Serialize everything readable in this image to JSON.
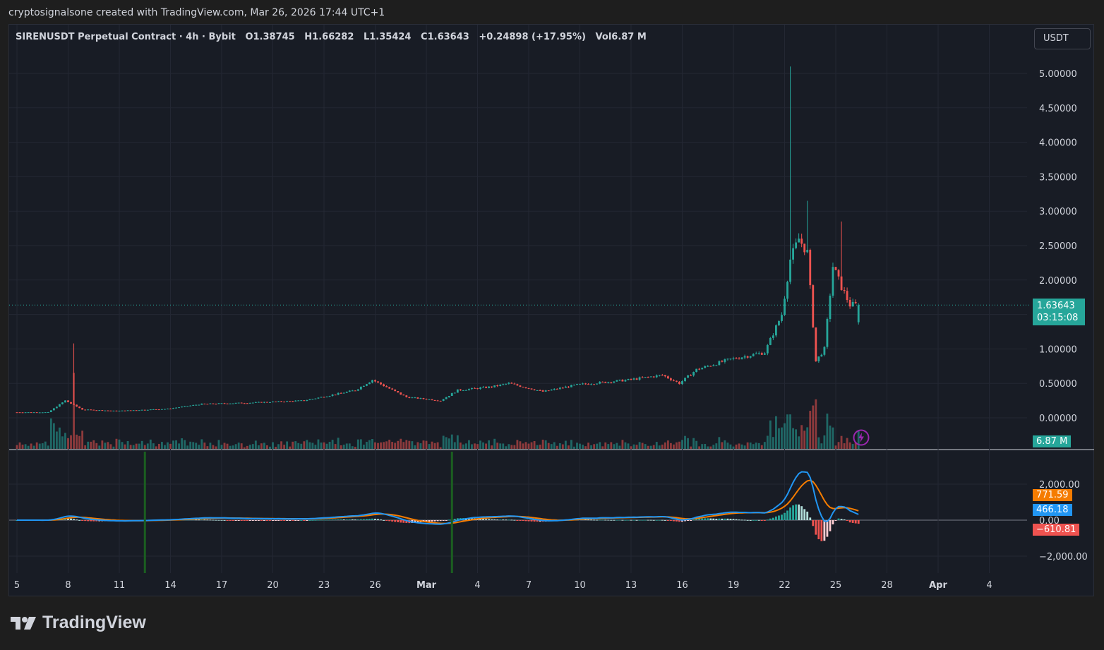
{
  "caption": "cryptosignalsone created with TradingView.com, Mar 26, 2026 17:44 UTC+1",
  "legend": {
    "symbol": "SIRENUSDT Perpetual Contract · 4h · Bybit",
    "open": "O1.38745",
    "high": "H1.66282",
    "low": "L1.35424",
    "close": "C1.63643",
    "change": "+0.24898 (+17.95%)",
    "volume": "Vol6.87 M"
  },
  "currency_button": "USDT",
  "last_price": "1.63643",
  "countdown": "03:15:08",
  "volume_tag": "6.87 M",
  "macd_signal_tag": "771.59",
  "macd_line_tag": "466.18",
  "macd_hist_tag": "−610.81",
  "brand": "TradingView",
  "icons": {
    "brand_logo": "tradingview-logo-icon",
    "flash": "lightning-icon"
  },
  "colors": {
    "up": "#26a69a",
    "down": "#ef5350",
    "macd": "#2196f3",
    "signal": "#f57c00",
    "background": "#181c25",
    "grid": "#232733",
    "text": "#d1d4dc"
  },
  "chart_data": [
    {
      "type": "candlestick",
      "title": "SIRENUSDT Perpetual Contract · 4h · Bybit",
      "x_ticks": [
        "5",
        "8",
        "11",
        "14",
        "17",
        "20",
        "23",
        "26",
        "Mar",
        "4",
        "7",
        "10",
        "13",
        "16",
        "19",
        "22",
        "25",
        "28",
        "Apr",
        "4"
      ],
      "y_ticks": [
        "0.00000",
        "0.50000",
        "1.00000",
        "1.50000",
        "2.00000",
        "2.50000",
        "3.00000",
        "3.50000",
        "4.00000",
        "4.50000",
        "5.00000"
      ],
      "ylim": [
        -0.2,
        5.3
      ],
      "last_close": 1.63643,
      "price_series": {
        "name": "close (approx.)",
        "x": [
          "Feb 5",
          "Feb 7",
          "Feb 8",
          "Feb 9",
          "Feb 11",
          "Feb 14",
          "Feb 16",
          "Feb 19",
          "Feb 22",
          "Feb 25",
          "Feb 26",
          "Feb 28",
          "Mar 2",
          "Mar 3",
          "Mar 5",
          "Mar 6",
          "Mar 8",
          "Mar 10",
          "Mar 13",
          "Mar 15",
          "Mar 16",
          "Mar 17",
          "Mar 19",
          "Mar 20",
          "Mar 21",
          "Mar 22",
          "Mar 22 12h",
          "Mar 23",
          "Mar 23 12h",
          "Mar 24",
          "Mar 24 12h",
          "Mar 25",
          "Mar 25 12h",
          "Mar 26"
        ],
        "close": [
          0.08,
          0.08,
          0.25,
          0.12,
          0.1,
          0.13,
          0.2,
          0.22,
          0.25,
          0.4,
          0.55,
          0.3,
          0.25,
          0.4,
          0.45,
          0.5,
          0.38,
          0.48,
          0.55,
          0.62,
          0.5,
          0.7,
          0.85,
          0.9,
          0.95,
          1.5,
          2.3,
          2.6,
          2.4,
          0.82,
          1.0,
          2.2,
          1.9,
          1.64
        ]
      },
      "price_highs": {
        "Feb 8": 1.08,
        "Mar 22": 5.1,
        "Mar 23": 3.15,
        "Mar 25": 2.85
      }
    },
    {
      "type": "bar",
      "title": "Volume",
      "last_value": "6.87 M"
    },
    {
      "type": "line",
      "title": "MACD",
      "y_ticks": [
        "−2,000.00",
        "0.00",
        "2,000.00"
      ],
      "ylim": [
        -2500,
        3500
      ],
      "series": [
        {
          "name": "MACD",
          "last": 466.18
        },
        {
          "name": "Signal",
          "last": 771.59
        },
        {
          "name": "Histogram",
          "last": -610.81
        }
      ]
    }
  ]
}
